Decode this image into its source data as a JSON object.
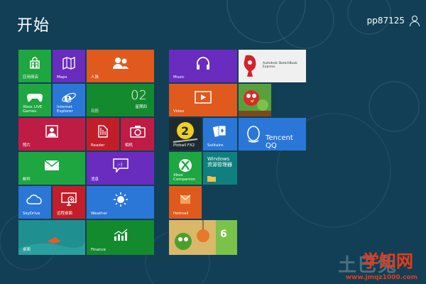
{
  "header": {
    "title": "开始",
    "username": "pp87125"
  },
  "tiles": {
    "store": "应用商店",
    "maps": "Maps",
    "people": "人脉",
    "music": "Music",
    "sketchbook": "Autodesk SketchBook Express",
    "xbox_live_games": "Xbox LIVE\nGames",
    "internet_explorer": "Internet\nExplorer",
    "calendar": "日历",
    "calendar_date": "02",
    "calendar_day": "星期四",
    "video": "Video",
    "photos": "照片",
    "reader": "Reader",
    "camera": "相机",
    "pinball_fx2": "Pinball FX2",
    "solitaire": "Solitaire",
    "tencent_qq": "Tencent QQ",
    "mail": "邮件",
    "messaging": "消息",
    "xbox_companion": "Xbox\nCompanion",
    "windows_explorer": "Windows\n资源管理器",
    "skydrive": "SkyDrive",
    "remote_desktop": "远程桌面",
    "weather": "Weather",
    "hotmail": "Hotmail",
    "desktop": "桌面",
    "finance": "Finance"
  },
  "watermarks": {
    "text1": "土巴兔",
    "text2": "学知网",
    "url": "www.jmqz1000.com"
  },
  "colors": {
    "background": "#123f55",
    "green": "#1ea640",
    "purple": "#6a2bbf",
    "blue": "#2a77d8",
    "orange": "#e05a1e",
    "red": "#c41d2a"
  }
}
